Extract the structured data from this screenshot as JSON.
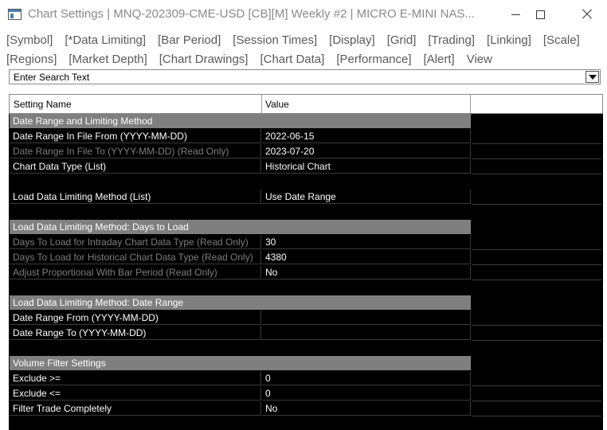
{
  "window": {
    "title": "Chart Settings | MNQ-202309-CME-USD [CB][M]  Weekly  #2 | MICRO E-MINI NAS..."
  },
  "tabs": {
    "row1": [
      "[Symbol]",
      "[*Data Limiting]",
      "[Bar Period]",
      "[Session Times]",
      "[Display]",
      "[Grid]",
      "[Trading]",
      "[Linking]",
      "[Scale]"
    ],
    "row2": [
      "[Regions]",
      "[Market Depth]",
      "[Chart Drawings]",
      "[Chart Data]",
      "[Performance]",
      "[Alert]",
      "View"
    ]
  },
  "search": {
    "placeholder": "Enter Search Text"
  },
  "grid": {
    "columns": [
      "Setting Name",
      "Value"
    ],
    "rows": [
      {
        "type": "section",
        "name": "Date Range and Limiting Method"
      },
      {
        "type": "data",
        "name": "Date Range In File From (YYYY-MM-DD)",
        "value": "2022-06-15"
      },
      {
        "type": "readonly",
        "name": "Date Range In File To (YYYY-MM-DD) (Read Only)",
        "value": "2023-07-20"
      },
      {
        "type": "data",
        "name": "Chart Data Type (List)",
        "value": "Historical Chart"
      },
      {
        "type": "blank"
      },
      {
        "type": "data",
        "name": "Load Data Limiting Method (List)",
        "value": "Use Date Range"
      },
      {
        "type": "blank"
      },
      {
        "type": "section",
        "name": "Load Data Limiting Method: Days to Load"
      },
      {
        "type": "readonly",
        "name": "Days To Load for Intraday Chart Data Type (Read Only)",
        "value": "30"
      },
      {
        "type": "readonly",
        "name": "Days To Load for Historical Chart Data Type (Read Only)",
        "value": "4380"
      },
      {
        "type": "readonly",
        "name": "Adjust Proportional With Bar Period (Read Only)",
        "value": "No"
      },
      {
        "type": "blank"
      },
      {
        "type": "section",
        "name": "Load Data Limiting Method: Date Range"
      },
      {
        "type": "data",
        "name": "Date Range From (YYYY-MM-DD)",
        "value": ""
      },
      {
        "type": "data",
        "name": "Date Range To (YYYY-MM-DD)",
        "value": ""
      },
      {
        "type": "blank"
      },
      {
        "type": "section",
        "name": "Volume Filter Settings"
      },
      {
        "type": "data",
        "name": "Exclude >=",
        "value": "0"
      },
      {
        "type": "data",
        "name": "Exclude <=",
        "value": "0"
      },
      {
        "type": "data",
        "name": "Filter Trade Completely",
        "value": "No"
      }
    ]
  },
  "colors": {
    "grid_background": "#000000",
    "section_background": "#7f7f7f",
    "readonly_text": "#7d7d7d",
    "tab_text": "#5a5a5a",
    "title_text": "#8a8a8a"
  }
}
